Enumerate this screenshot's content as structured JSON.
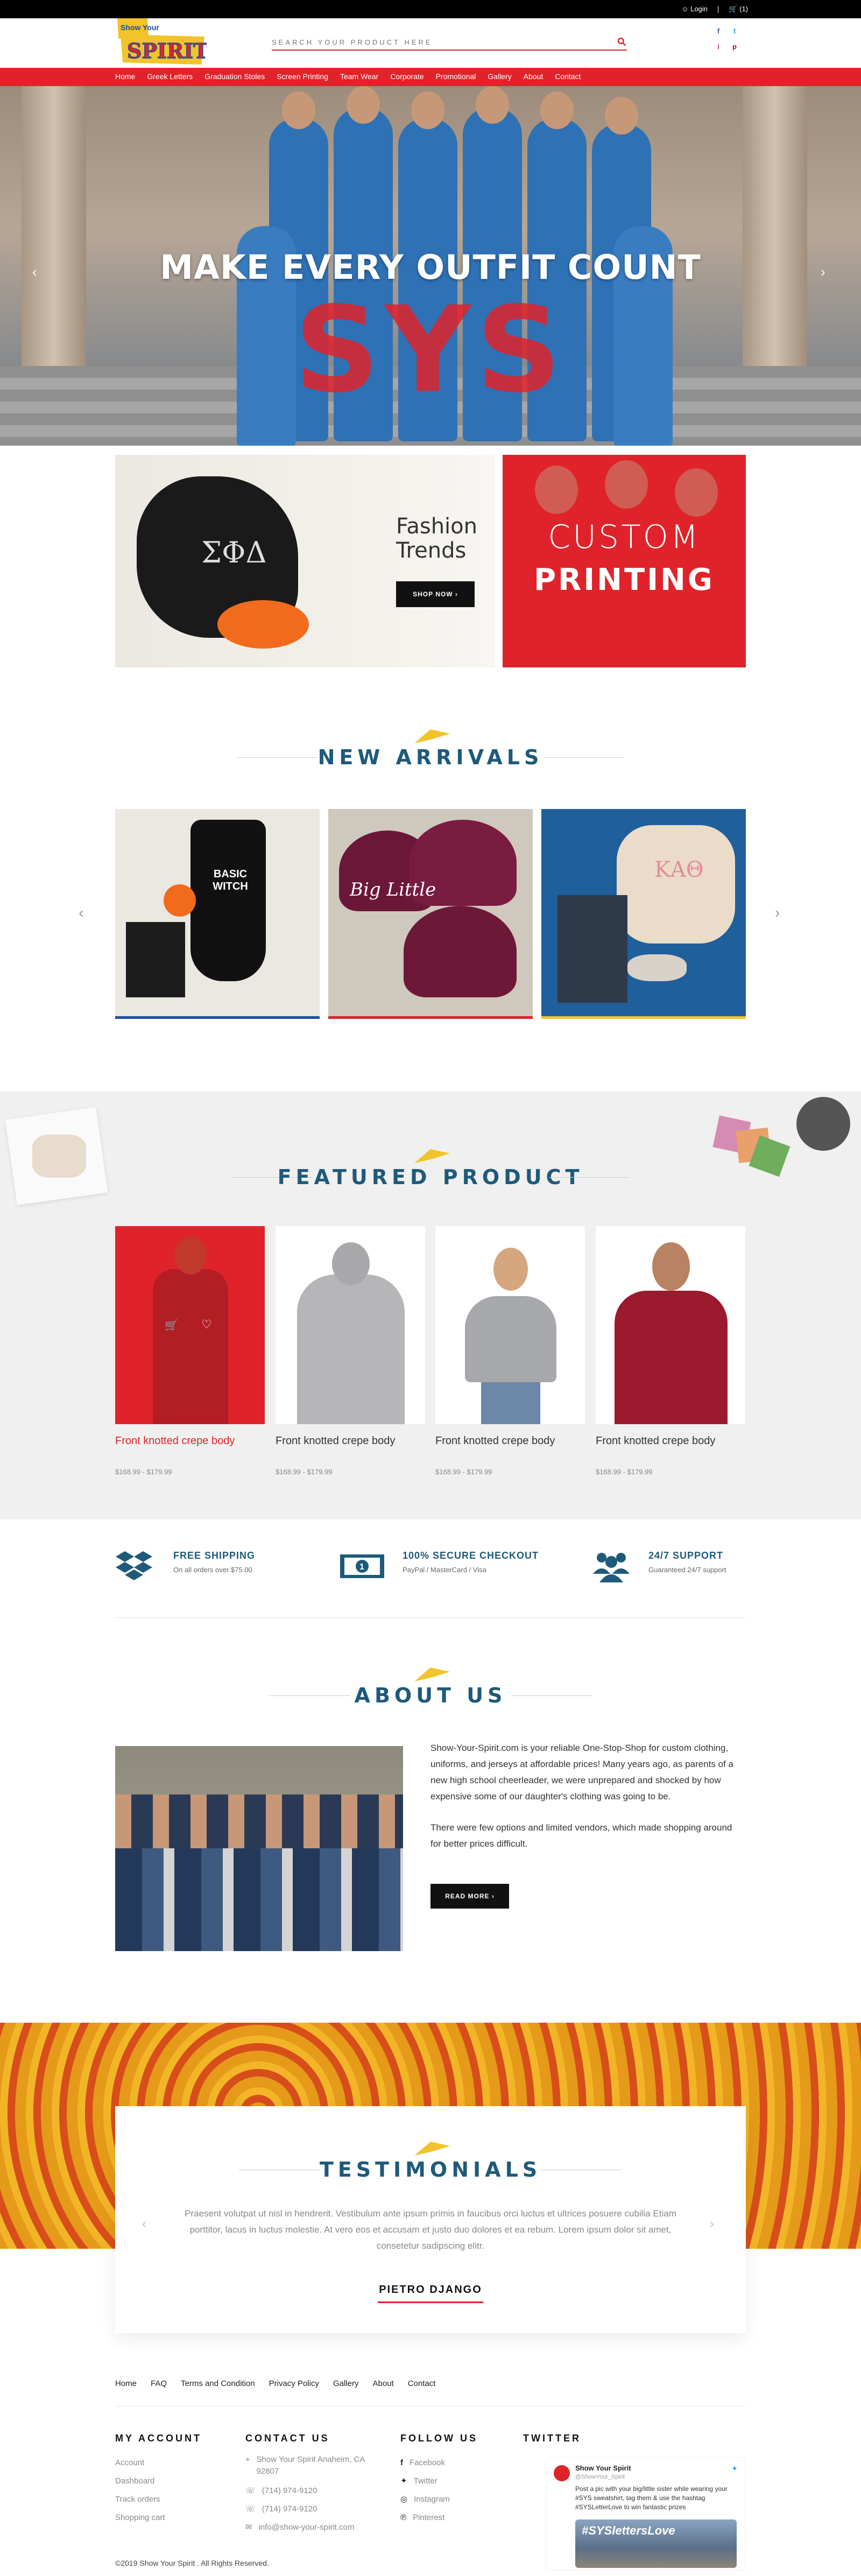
{
  "topbar": {
    "login": "Login",
    "cart": "(1)"
  },
  "header": {
    "logo_show": "Show Your",
    "logo_spirit": "SPIRIT",
    "search_placeholder": "SEARCH YOUR PRODUCT HERE"
  },
  "social_top": [
    "f",
    "t",
    "i",
    "p"
  ],
  "nav": [
    "Home",
    "Greek Letters",
    "Graduation Stoles",
    "Screen Printing",
    "Team Wear",
    "Corporate",
    "Promotional",
    "Gallery",
    "About",
    "Contact"
  ],
  "hero": {
    "title": "MAKE EVERY OUTFIT COUNT"
  },
  "promo": {
    "fashion_line1": "Fashion",
    "fashion_line2": "Trends",
    "shop_now": "SHOP NOW",
    "custom_line1": "CUSTOM",
    "custom_line2": "PRINTING",
    "hoodie_letters": "ΣΦΔ"
  },
  "new_arrivals": {
    "title": "NEW ARRIVALS",
    "items": [
      {
        "print": "BASIC WITCH",
        "bar": "#1e4fa0"
      },
      {
        "print": "Big Little",
        "bar": "#e0232a"
      },
      {
        "print": "ΚΑΘ",
        "bar": "#f2c32a"
      }
    ]
  },
  "featured": {
    "title": "FEATURED PRODUCT",
    "items": [
      {
        "name": "Front knotted crepe body",
        "price": "$168.99 - $179.99",
        "highlight": true
      },
      {
        "name": "Front knotted crepe body",
        "price": "$168.99 - $179.99",
        "highlight": false
      },
      {
        "name": "Front knotted crepe body",
        "price": "$168.99 - $179.99",
        "highlight": false
      },
      {
        "name": "Front knotted crepe body",
        "price": "$168.99 - $179.99",
        "highlight": false
      }
    ]
  },
  "features": [
    {
      "title": "FREE SHIPPING",
      "sub": "On all orders over $75.00"
    },
    {
      "title": "100% SECURE CHECKOUT",
      "sub": "PayPal / MasterCard / Visa"
    },
    {
      "title": "24/7 SUPPORT",
      "sub": "Guaranteed 24/7 support"
    }
  ],
  "about": {
    "title": "ABOUT US",
    "p1": "Show-Your-Spirit.com is your reliable One-Stop-Shop for custom clothing, uniforms, and jerseys at affordable prices! Many years ago, as parents of a new high school cheerleader, we were unprepared and shocked by how expensive some of our daughter's clothing was going to be.",
    "p2": "There were few options and limited vendors, which made shopping around for better prices difficult.",
    "read_more": "READ MORE"
  },
  "testimonials": {
    "title": "TESTIMONIALS",
    "text": "Praesent volutpat ut nisl in hendrerit. Vestibulum ante ipsum primis in faucibus orci luctus et ultrices posuere cubilia Etiam porttitor, lacus in luctus molestie. At vero eos et accusam et justo duo dolores et ea rebum. Lorem ipsum dolor sit amet, consetetur sadipscing elitr.",
    "name": "PIETRO DJANGO"
  },
  "footer": {
    "nav": [
      "Home",
      "FAQ",
      "Terms and Condition",
      "Privacy Policy",
      "Gallery",
      "About",
      "Contact"
    ],
    "my_account": {
      "title": "MY ACCOUNT",
      "items": [
        "Account",
        "Dashboard",
        "Track orders",
        "Shopping cart"
      ]
    },
    "contact": {
      "title": "CONTACT US",
      "address": "Show Your Spirit Anaheim, CA 92807",
      "phone1": "(714) 974-9120",
      "phone2": "(714) 974-9120",
      "email": "info@show-your-spirit.com"
    },
    "follow": {
      "title": "FOLLOW US",
      "items": [
        "Facebook",
        "Twitter",
        "Instagram",
        "Pinterest"
      ]
    },
    "twitter": {
      "title": "TWITTER",
      "account": "Show Your Spirit",
      "handle": "@ShowYour_Spirit",
      "tweet": "Post a pic with your big/little sister while wearing your #SYS sweatshirt, tag them & use the hashtag #SYSLetterLove to win fantastic prizes",
      "image_text": "#SYSlettersLove"
    },
    "copyright": "©2019 Show Your Spirit . All Rights Reserved."
  },
  "colors": {
    "brand_red": "#e0232a",
    "brand_blue": "#1e5a7a",
    "accent_yellow": "#f2c32a"
  }
}
